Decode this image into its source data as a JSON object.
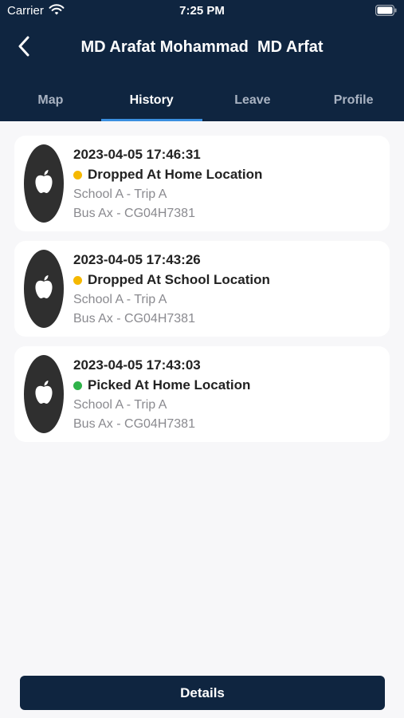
{
  "status_bar": {
    "carrier": "Carrier",
    "time": "7:25 PM",
    "wifi_icon": "wifi-icon",
    "battery_icon": "battery-icon"
  },
  "header": {
    "back_icon": "chevron-left-icon",
    "title": "MD Arafat Mohammad  MD Arfat"
  },
  "tabs": [
    {
      "label": "Map",
      "active": false
    },
    {
      "label": "History",
      "active": true
    },
    {
      "label": "Leave",
      "active": false
    },
    {
      "label": "Profile",
      "active": false
    }
  ],
  "history": [
    {
      "avatar_icon": "apple-logo-icon",
      "datetime": "2023-04-05 17:46:31",
      "status": "Dropped At Home Location",
      "status_color": "#f5b800",
      "trip": "School A - Trip A",
      "bus": "Bus Ax - CG04H7381"
    },
    {
      "avatar_icon": "apple-logo-icon",
      "datetime": "2023-04-05 17:43:26",
      "status": "Dropped At School Location",
      "status_color": "#f5b800",
      "trip": "School A - Trip A",
      "bus": "Bus Ax - CG04H7381"
    },
    {
      "avatar_icon": "apple-logo-icon",
      "datetime": "2023-04-05 17:43:03",
      "status": "Picked At Home Location",
      "status_color": "#2fb34a",
      "trip": "School A - Trip A",
      "bus": "Bus Ax - CG04H7381"
    }
  ],
  "footer": {
    "details_label": "Details"
  },
  "colors": {
    "primary": "#0f2540",
    "tab_indicator": "#3a8fe0",
    "background": "#f7f7f9"
  }
}
